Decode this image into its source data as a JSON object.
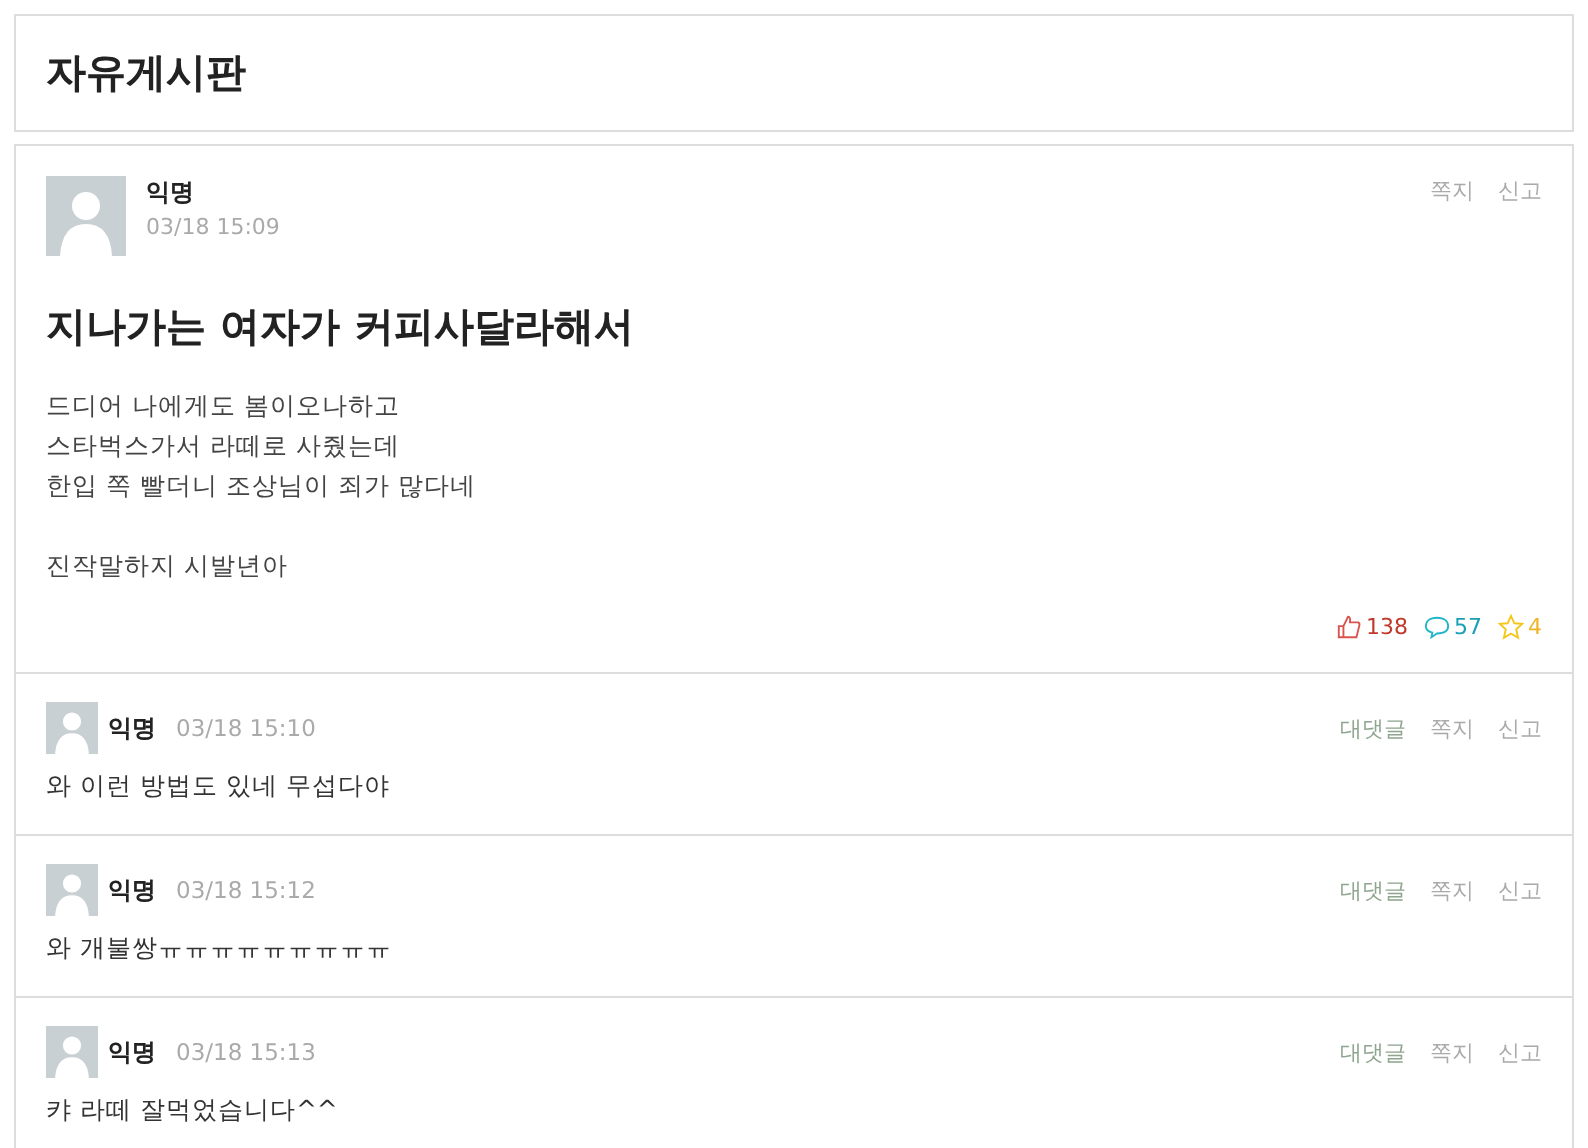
{
  "board": {
    "title": "자유게시판"
  },
  "post": {
    "author": "익명",
    "time": "03/18 15:09",
    "actions": [
      "쪽지",
      "신고"
    ],
    "title": "지나가는 여자가 커피사달라해서",
    "paragraphs": [
      [
        "드디어 나에게도 봄이오나하고",
        "스타벅스가서 라떼로 사줬는데",
        "한입 쪽 빨더니 조상님이 죄가 많다네"
      ],
      [
        "진작말하지 시발년아"
      ]
    ],
    "likes": "138",
    "comments": "57",
    "stars_count": "4"
  },
  "comments": [
    {
      "author": "익명",
      "time": "03/18 15:10",
      "actions": [
        "대댓글",
        "쪽지",
        "신고"
      ],
      "text": "와 이런 방법도 있네 무섭다야"
    },
    {
      "author": "익명",
      "time": "03/18 15:12",
      "actions": [
        "대댓글",
        "쪽지",
        "신고"
      ],
      "text": "와 개불쌍ㅠㅠㅠㅠㅠㅠㅠㅠㅠ"
    },
    {
      "author": "익명",
      "time": "03/18 15:13",
      "actions": [
        "대댓글",
        "쪽지",
        "신고"
      ],
      "text": "캬 라떼 잘먹었습니다^^"
    }
  ]
}
